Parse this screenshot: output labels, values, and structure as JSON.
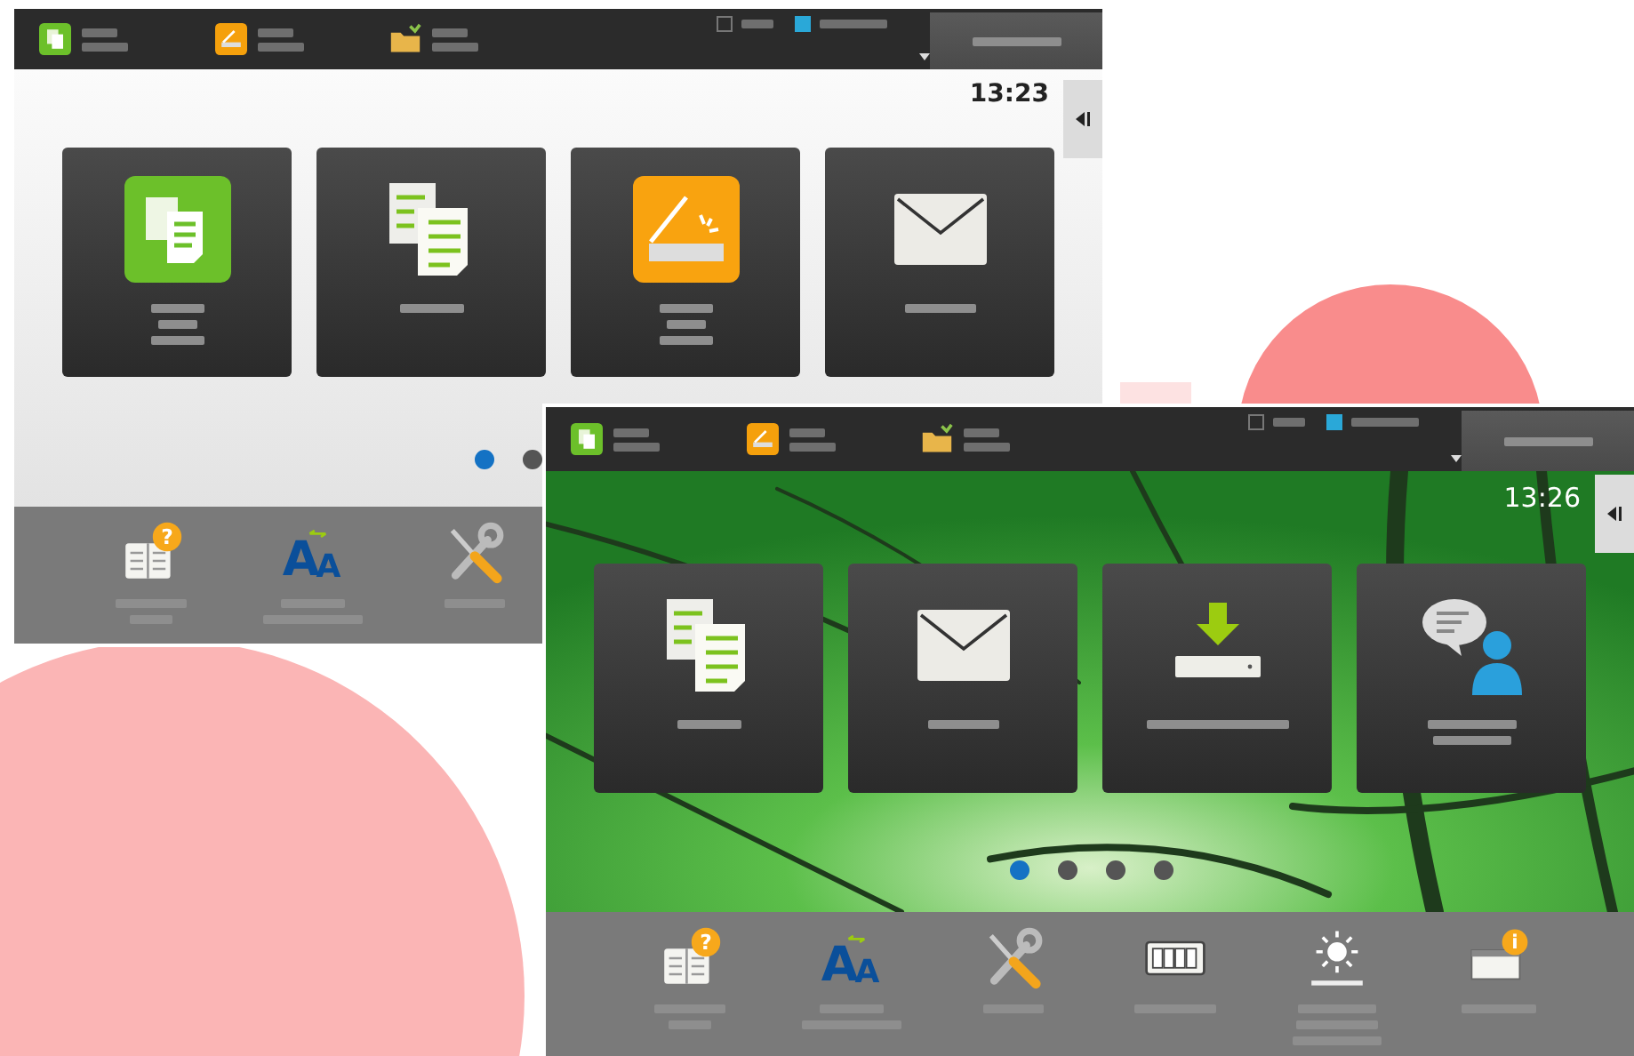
{
  "screens": [
    {
      "kind": "plain",
      "clock": "13:23",
      "status": [
        {
          "kind": "copy"
        },
        {
          "kind": "scan"
        },
        {
          "kind": "folder"
        }
      ],
      "toggles": [
        {
          "checked": false
        },
        {
          "checked": true
        }
      ],
      "tiles": [
        {
          "kind": "copy-green"
        },
        {
          "kind": "copy"
        },
        {
          "kind": "scan"
        },
        {
          "kind": "email"
        }
      ],
      "page_dots": [
        {
          "selected": true
        },
        {
          "selected": false
        }
      ],
      "dock": [
        {
          "kind": "guide",
          "badge": "?"
        },
        {
          "kind": "font",
          "letters": [
            "A",
            "A"
          ]
        },
        {
          "kind": "tools"
        }
      ]
    },
    {
      "kind": "photo",
      "clock": "13:26",
      "status": [
        {
          "kind": "copy"
        },
        {
          "kind": "scan"
        },
        {
          "kind": "folder"
        }
      ],
      "toggles": [
        {
          "checked": false
        },
        {
          "checked": true
        }
      ],
      "tiles": [
        {
          "kind": "copy"
        },
        {
          "kind": "email"
        },
        {
          "kind": "scan-hdd"
        },
        {
          "kind": "language"
        }
      ],
      "page_dots": [
        {
          "selected": true
        },
        {
          "selected": false
        },
        {
          "selected": false
        },
        {
          "selected": false
        }
      ],
      "dock": [
        {
          "kind": "guide",
          "badge": "?"
        },
        {
          "kind": "font",
          "letters": [
            "A",
            "A"
          ]
        },
        {
          "kind": "tools"
        },
        {
          "kind": "counter"
        },
        {
          "kind": "brightness"
        },
        {
          "kind": "info",
          "badge": "i"
        }
      ]
    }
  ]
}
